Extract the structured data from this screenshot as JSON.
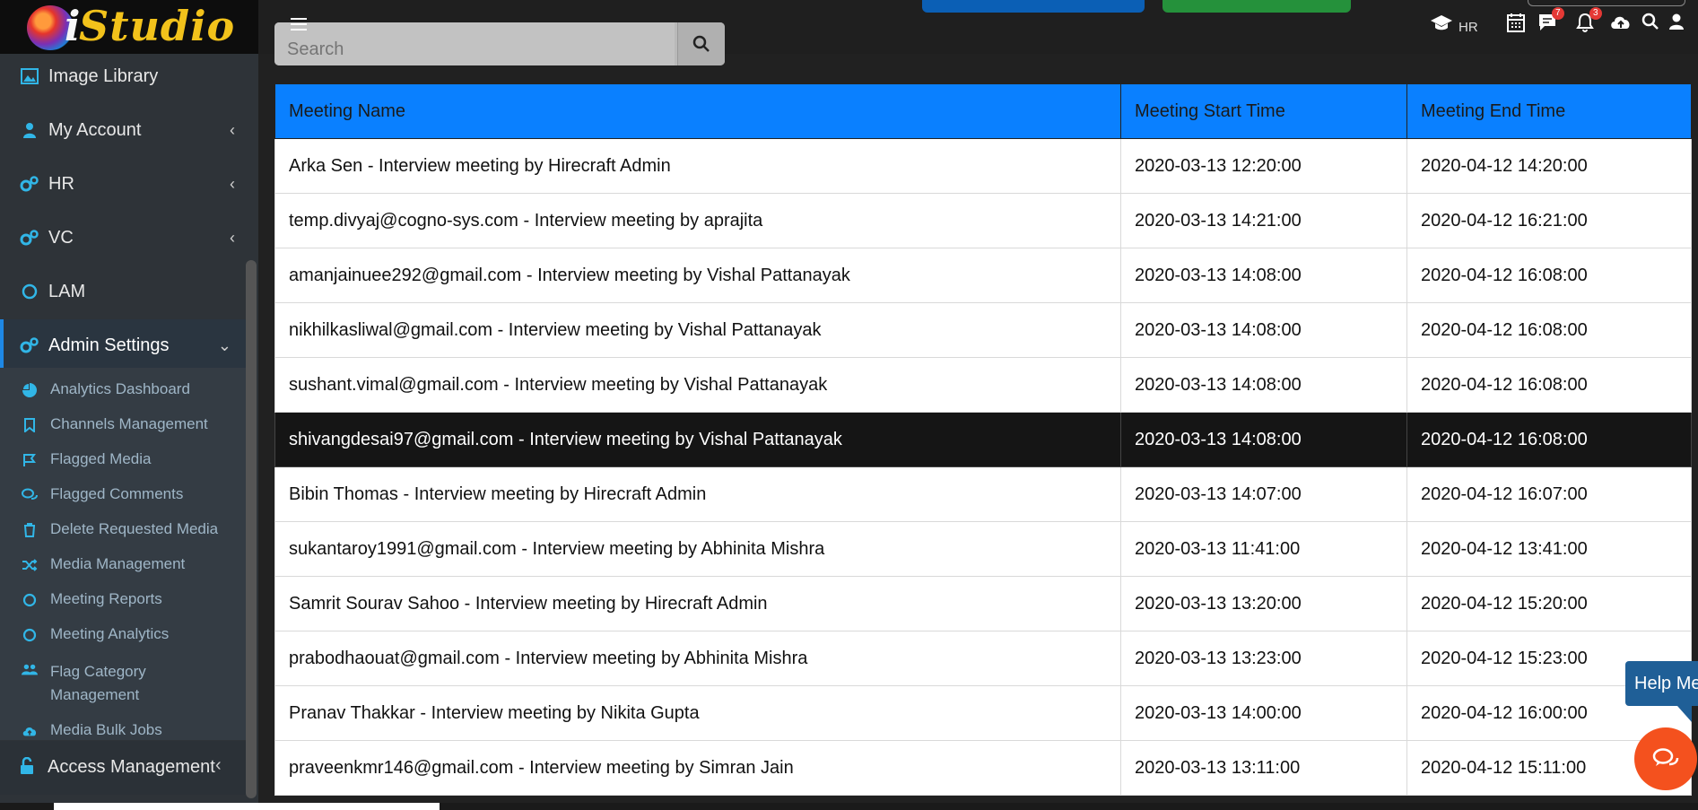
{
  "brand": {
    "logo_text": "Studio",
    "logo_prefix": "i"
  },
  "search": {
    "placeholder": "Search"
  },
  "header": {
    "user_role": "HR",
    "chat_badge": "7",
    "notification_badge": "3"
  },
  "sidebar": {
    "items": [
      {
        "label": "Image Library"
      },
      {
        "label": "My Account"
      },
      {
        "label": "HR"
      },
      {
        "label": "VC"
      },
      {
        "label": "LAM"
      },
      {
        "label": "Admin Settings"
      }
    ],
    "submenu": [
      {
        "label": "Analytics Dashboard"
      },
      {
        "label": "Channels Management"
      },
      {
        "label": "Flagged Media"
      },
      {
        "label": "Flagged Comments"
      },
      {
        "label": "Delete Requested Media"
      },
      {
        "label": "Media Management"
      },
      {
        "label": "Meeting Reports"
      },
      {
        "label": "Meeting Analytics"
      },
      {
        "label": "Flag Category Management"
      },
      {
        "label": "Media Bulk Jobs"
      }
    ],
    "access": {
      "label": "Access Management"
    }
  },
  "table": {
    "headers": [
      "Meeting Name",
      "Meeting Start Time",
      "Meeting End Time"
    ],
    "rows": [
      [
        "Arka Sen - Interview meeting by Hirecraft Admin",
        "2020-03-13 12:20:00",
        "2020-04-12 14:20:00"
      ],
      [
        "temp.divyaj@cogno-sys.com - Interview meeting by aprajita",
        "2020-03-13 14:21:00",
        "2020-04-12 16:21:00"
      ],
      [
        "amanjainuee292@gmail.com - Interview meeting by Vishal Pattanayak",
        "2020-03-13 14:08:00",
        "2020-04-12 16:08:00"
      ],
      [
        "nikhilkasliwal@gmail.com - Interview meeting by Vishal Pattanayak",
        "2020-03-13 14:08:00",
        "2020-04-12 16:08:00"
      ],
      [
        "sushant.vimal@gmail.com - Interview meeting by Vishal Pattanayak",
        "2020-03-13 14:08:00",
        "2020-04-12 16:08:00"
      ],
      [
        "shivangdesai97@gmail.com - Interview meeting by Vishal Pattanayak",
        "2020-03-13 14:08:00",
        "2020-04-12 16:08:00"
      ],
      [
        "Bibin Thomas - Interview meeting by Hirecraft Admin",
        "2020-03-13 14:07:00",
        "2020-04-12 16:07:00"
      ],
      [
        "sukantaroy1991@gmail.com - Interview meeting by Abhinita Mishra",
        "2020-03-13 11:41:00",
        "2020-04-12 13:41:00"
      ],
      [
        "Samrit Sourav Sahoo - Interview meeting by Hirecraft Admin",
        "2020-03-13 13:20:00",
        "2020-04-12 15:20:00"
      ],
      [
        "prabodhaouat@gmail.com - Interview meeting by Abhinita Mishra",
        "2020-03-13 13:23:00",
        "2020-04-12 15:23:00"
      ],
      [
        "Pranav Thakkar - Interview meeting by Nikita Gupta",
        "2020-03-13 14:00:00",
        "2020-04-12 16:00:00"
      ],
      [
        "praveenkmr146@gmail.com - Interview meeting by Simran Jain",
        "2020-03-13 13:11:00",
        "2020-04-12 15:11:00"
      ]
    ],
    "selected_row": 5
  },
  "help": {
    "label": "Help Me"
  },
  "colors": {
    "header_blue": "#0a80ff",
    "sidebar_bg": "#2e3338",
    "accent_cyan": "#31b6e7",
    "chat_orange": "#f4511e"
  }
}
